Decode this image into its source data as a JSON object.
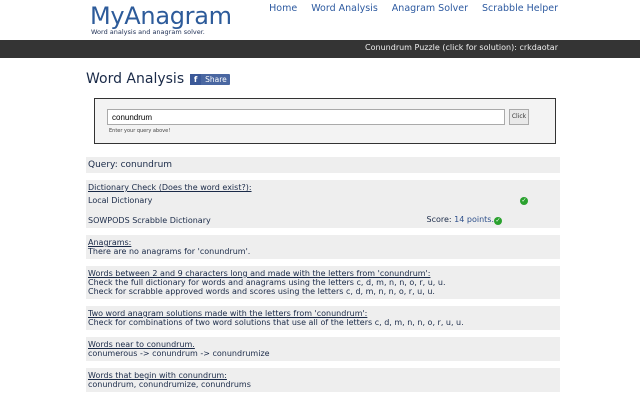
{
  "header": {
    "logo_title": "MyAnagram",
    "logo_sub": "Word analysis and anagram solver.",
    "nav": [
      "Home",
      "Word Analysis",
      "Anagram Solver",
      "Scrabble Helper"
    ]
  },
  "bar": {
    "text": "Conundrum Puzzle (click for solution): crkdaotar"
  },
  "main": {
    "title": "Word Analysis",
    "share_label": "Share",
    "share_glyph": "f",
    "search": {
      "value": "conundrum",
      "button": "Click",
      "hint": "Enter your query above!"
    },
    "query": "Query: conundrum",
    "dict": {
      "heading": "Dictionary Check (Does the word exist?):",
      "local": "Local Dictionary",
      "sowpods": "SOWPODS Scrabble Dictionary",
      "score_prefix": "Score:",
      "score_value": "14 points."
    },
    "anagrams": {
      "heading": "Anagrams:",
      "text": "There are no anagrams for 'conundrum'."
    },
    "words": {
      "heading": "Words between 2 and 9 characters long and made with the letters from 'conundrum':",
      "line1": "Check the full dictionary for words and anagrams using the letters c, d, m, n, n, o, r, u, u.",
      "line2": "Check for scrabble approved words and scores using the letters c, d, m, n, n, o, r, u, u."
    },
    "two_word": {
      "heading": "Two word anagram solutions made with the letters from 'conundrum':",
      "line1": "Check for combinations of two word solutions that use all of the letters c, d, m, n, n, o, r, u, u."
    },
    "near": {
      "heading": "Words near to conundrum.",
      "line1": "conumerous -> conundrum -> conundrumize"
    },
    "begin": {
      "heading": "Words that begin with conundrum:",
      "line1": "conundrum, conundrumize, conundrums"
    }
  }
}
